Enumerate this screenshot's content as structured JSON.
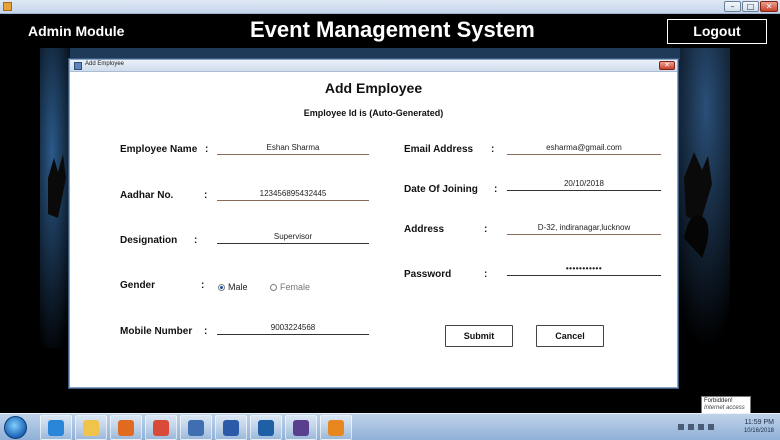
{
  "window": {
    "min": "–",
    "max": "□",
    "close": "✕"
  },
  "header": {
    "admin_label": "Admin Module",
    "title": "Event Management System",
    "logout_label": "Logout"
  },
  "dialog": {
    "title": "Add Employee",
    "close": "✕",
    "heading": "Add Employee",
    "subheading": "Employee Id is (Auto-Generated)",
    "colon": ":"
  },
  "form": {
    "employee_name": {
      "label": "Employee Name",
      "value": "Eshan Sharma"
    },
    "aadhar": {
      "label": "Aadhar No.",
      "value": "123456895432445"
    },
    "designation": {
      "label": "Designation",
      "value": "Supervisor"
    },
    "gender": {
      "label": "Gender",
      "options": [
        "Male",
        "Female"
      ],
      "selected": "Male"
    },
    "mobile": {
      "label": "Mobile Number",
      "value": "9003224568"
    },
    "email": {
      "label": "Email Address",
      "value": "esharma@gmail.com"
    },
    "doj": {
      "label": "Date Of Joining",
      "value": "20/10/2018"
    },
    "address": {
      "label": "Address",
      "value": "D-32, indiranagar,lucknow"
    },
    "password": {
      "label": "Password",
      "value": "•••••••••••"
    }
  },
  "buttons": {
    "submit": "Submit",
    "cancel": "Cancel"
  },
  "taskbar": {
    "clock_time": "11:59 PM",
    "clock_date": "10/16/2018",
    "items": [
      {
        "name": "ie",
        "color": "#2a86d8"
      },
      {
        "name": "explorer",
        "color": "#f0c34a"
      },
      {
        "name": "outlook",
        "color": "#e06a1f"
      },
      {
        "name": "chrome",
        "color": "#d94a38"
      },
      {
        "name": "media",
        "color": "#3f6fb0"
      },
      {
        "name": "word",
        "color": "#2a5aa8"
      },
      {
        "name": "virtualbox",
        "color": "#1f5fa6"
      },
      {
        "name": "eclipse",
        "color": "#5b3f8f"
      },
      {
        "name": "java",
        "color": "#e7871f"
      }
    ]
  },
  "tooltip": {
    "line1": "Forbidden!",
    "line2": "Internet access"
  }
}
